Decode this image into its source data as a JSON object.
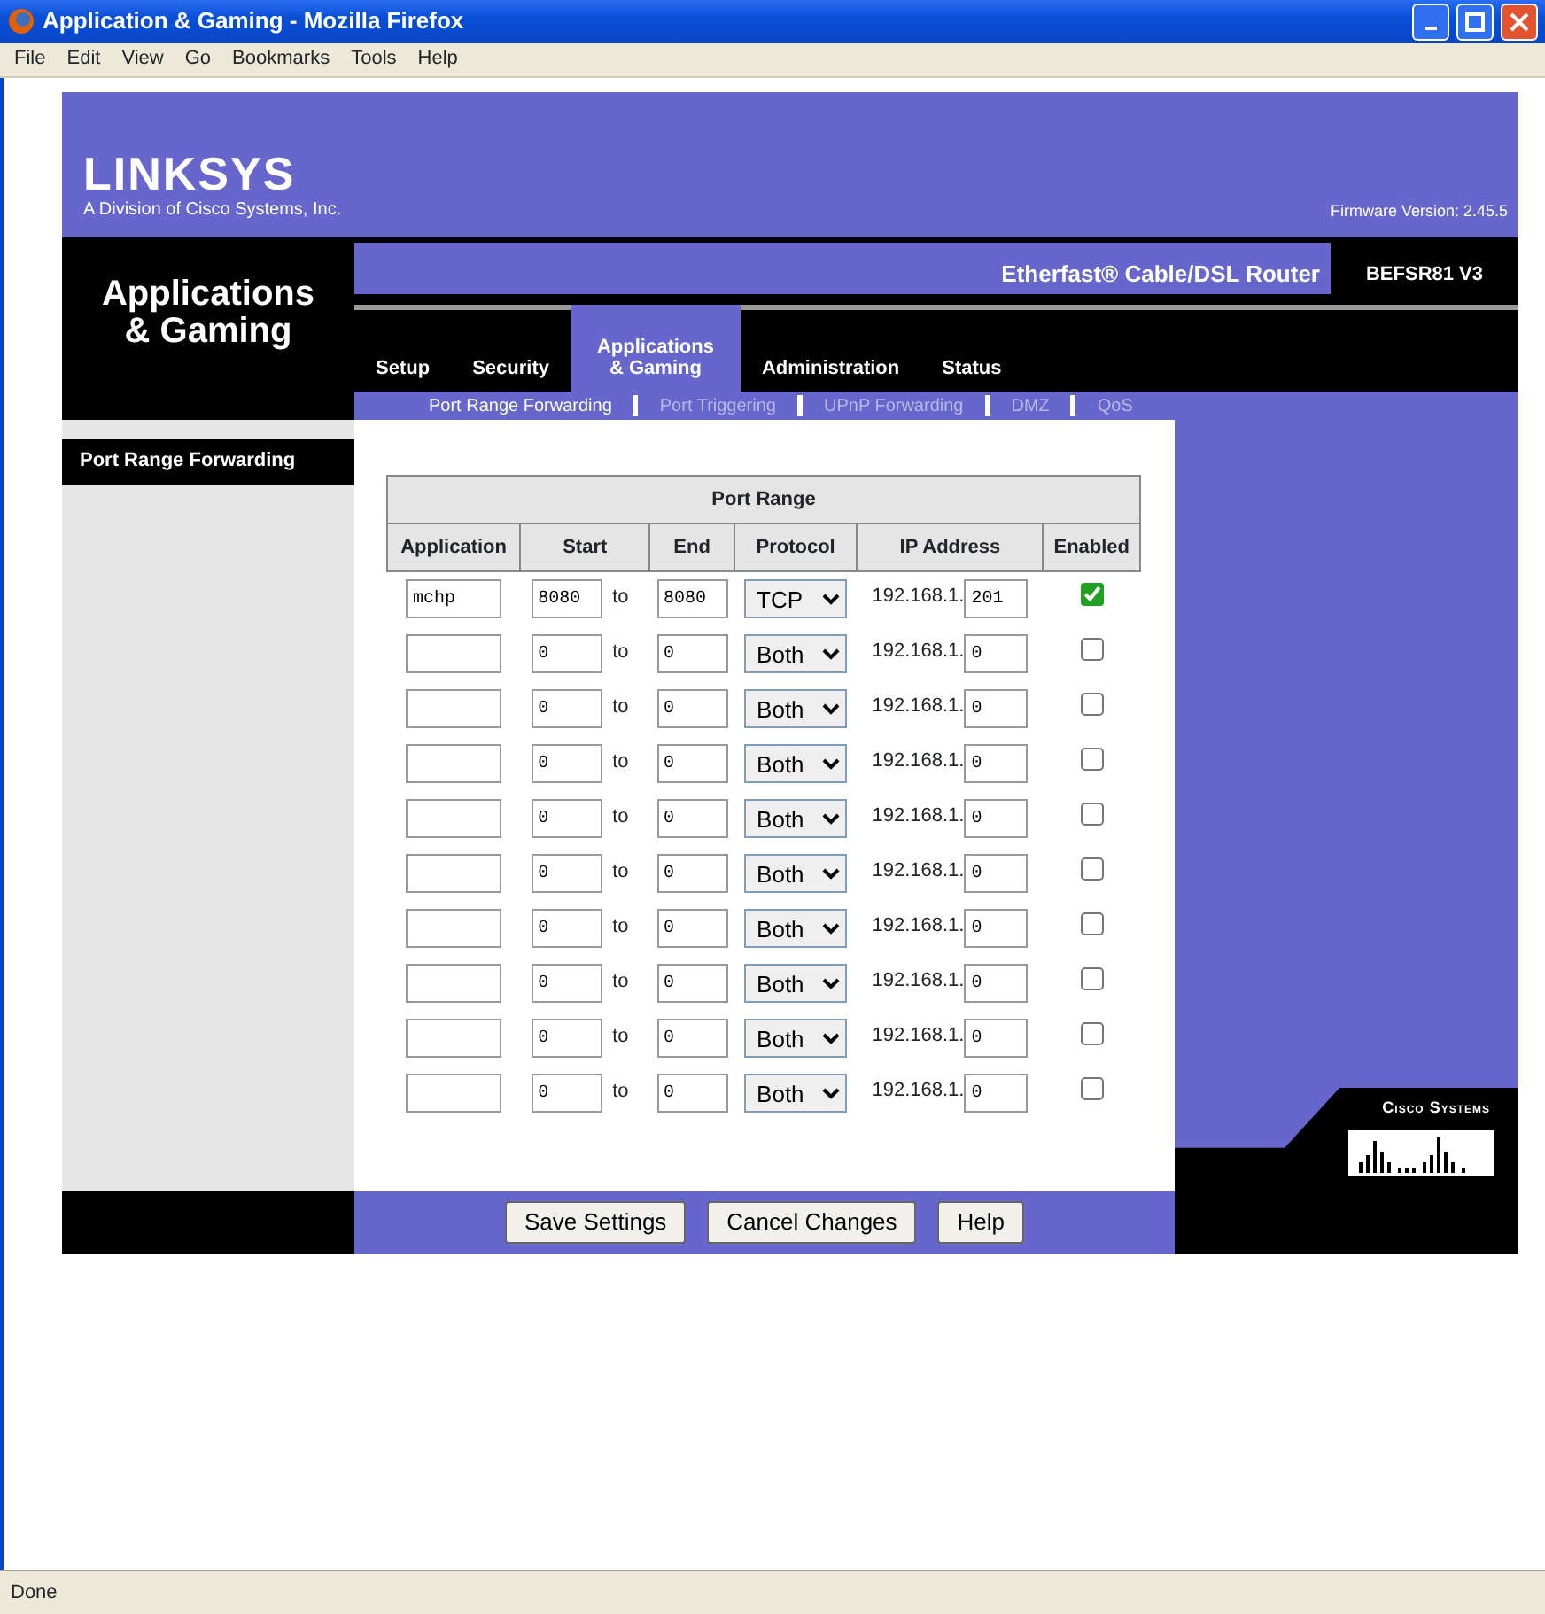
{
  "window": {
    "title": "Application & Gaming - Mozilla Firefox"
  },
  "menu": [
    "File",
    "Edit",
    "View",
    "Go",
    "Bookmarks",
    "Tools",
    "Help"
  ],
  "header": {
    "logo": "LINKSYS",
    "tagline": "A Division of Cisco Systems, Inc.",
    "firmware": "Firmware Version: 2.45.5"
  },
  "section_title": "Applications & Gaming",
  "product": {
    "name": "Etherfast® Cable/DSL Router",
    "model": "BEFSR81 V3"
  },
  "tabs": [
    {
      "label": "Setup",
      "selected": false
    },
    {
      "label": "Security",
      "selected": false
    },
    {
      "label": "Applications & Gaming",
      "selected": true
    },
    {
      "label": "Administration",
      "selected": false
    },
    {
      "label": "Status",
      "selected": false
    }
  ],
  "subtabs": [
    {
      "label": "Port Range Forwarding",
      "selected": true
    },
    {
      "label": "Port Triggering",
      "selected": false
    },
    {
      "label": "UPnP Forwarding",
      "selected": false
    },
    {
      "label": "DMZ",
      "selected": false
    },
    {
      "label": "QoS",
      "selected": false
    }
  ],
  "sidebar_label": "Port Range Forwarding",
  "table": {
    "group_heading": "Port Range",
    "columns": [
      "Application",
      "Start",
      "End",
      "Protocol",
      "IP Address",
      "Enabled"
    ],
    "rows": [
      {
        "application": "mchp",
        "start": "8080",
        "to": "to",
        "end": "8080",
        "protocol": "TCP",
        "ip_prefix": "192.168.1.",
        "ip_last": "201",
        "enabled": true
      },
      {
        "application": "",
        "start": "0",
        "to": "to",
        "end": "0",
        "protocol": "Both",
        "ip_prefix": "192.168.1.",
        "ip_last": "0",
        "enabled": false
      },
      {
        "application": "",
        "start": "0",
        "to": "to",
        "end": "0",
        "protocol": "Both",
        "ip_prefix": "192.168.1.",
        "ip_last": "0",
        "enabled": false
      },
      {
        "application": "",
        "start": "0",
        "to": "to",
        "end": "0",
        "protocol": "Both",
        "ip_prefix": "192.168.1.",
        "ip_last": "0",
        "enabled": false
      },
      {
        "application": "",
        "start": "0",
        "to": "to",
        "end": "0",
        "protocol": "Both",
        "ip_prefix": "192.168.1.",
        "ip_last": "0",
        "enabled": false
      },
      {
        "application": "",
        "start": "0",
        "to": "to",
        "end": "0",
        "protocol": "Both",
        "ip_prefix": "192.168.1.",
        "ip_last": "0",
        "enabled": false
      },
      {
        "application": "",
        "start": "0",
        "to": "to",
        "end": "0",
        "protocol": "Both",
        "ip_prefix": "192.168.1.",
        "ip_last": "0",
        "enabled": false
      },
      {
        "application": "",
        "start": "0",
        "to": "to",
        "end": "0",
        "protocol": "Both",
        "ip_prefix": "192.168.1.",
        "ip_last": "0",
        "enabled": false
      },
      {
        "application": "",
        "start": "0",
        "to": "to",
        "end": "0",
        "protocol": "Both",
        "ip_prefix": "192.168.1.",
        "ip_last": "0",
        "enabled": false
      },
      {
        "application": "",
        "start": "0",
        "to": "to",
        "end": "0",
        "protocol": "Both",
        "ip_prefix": "192.168.1.",
        "ip_last": "0",
        "enabled": false
      }
    ]
  },
  "cisco_logo": "Cisco Systems",
  "buttons": [
    "Save Settings",
    "Cancel Changes",
    "Help"
  ],
  "status_bar": "Done"
}
